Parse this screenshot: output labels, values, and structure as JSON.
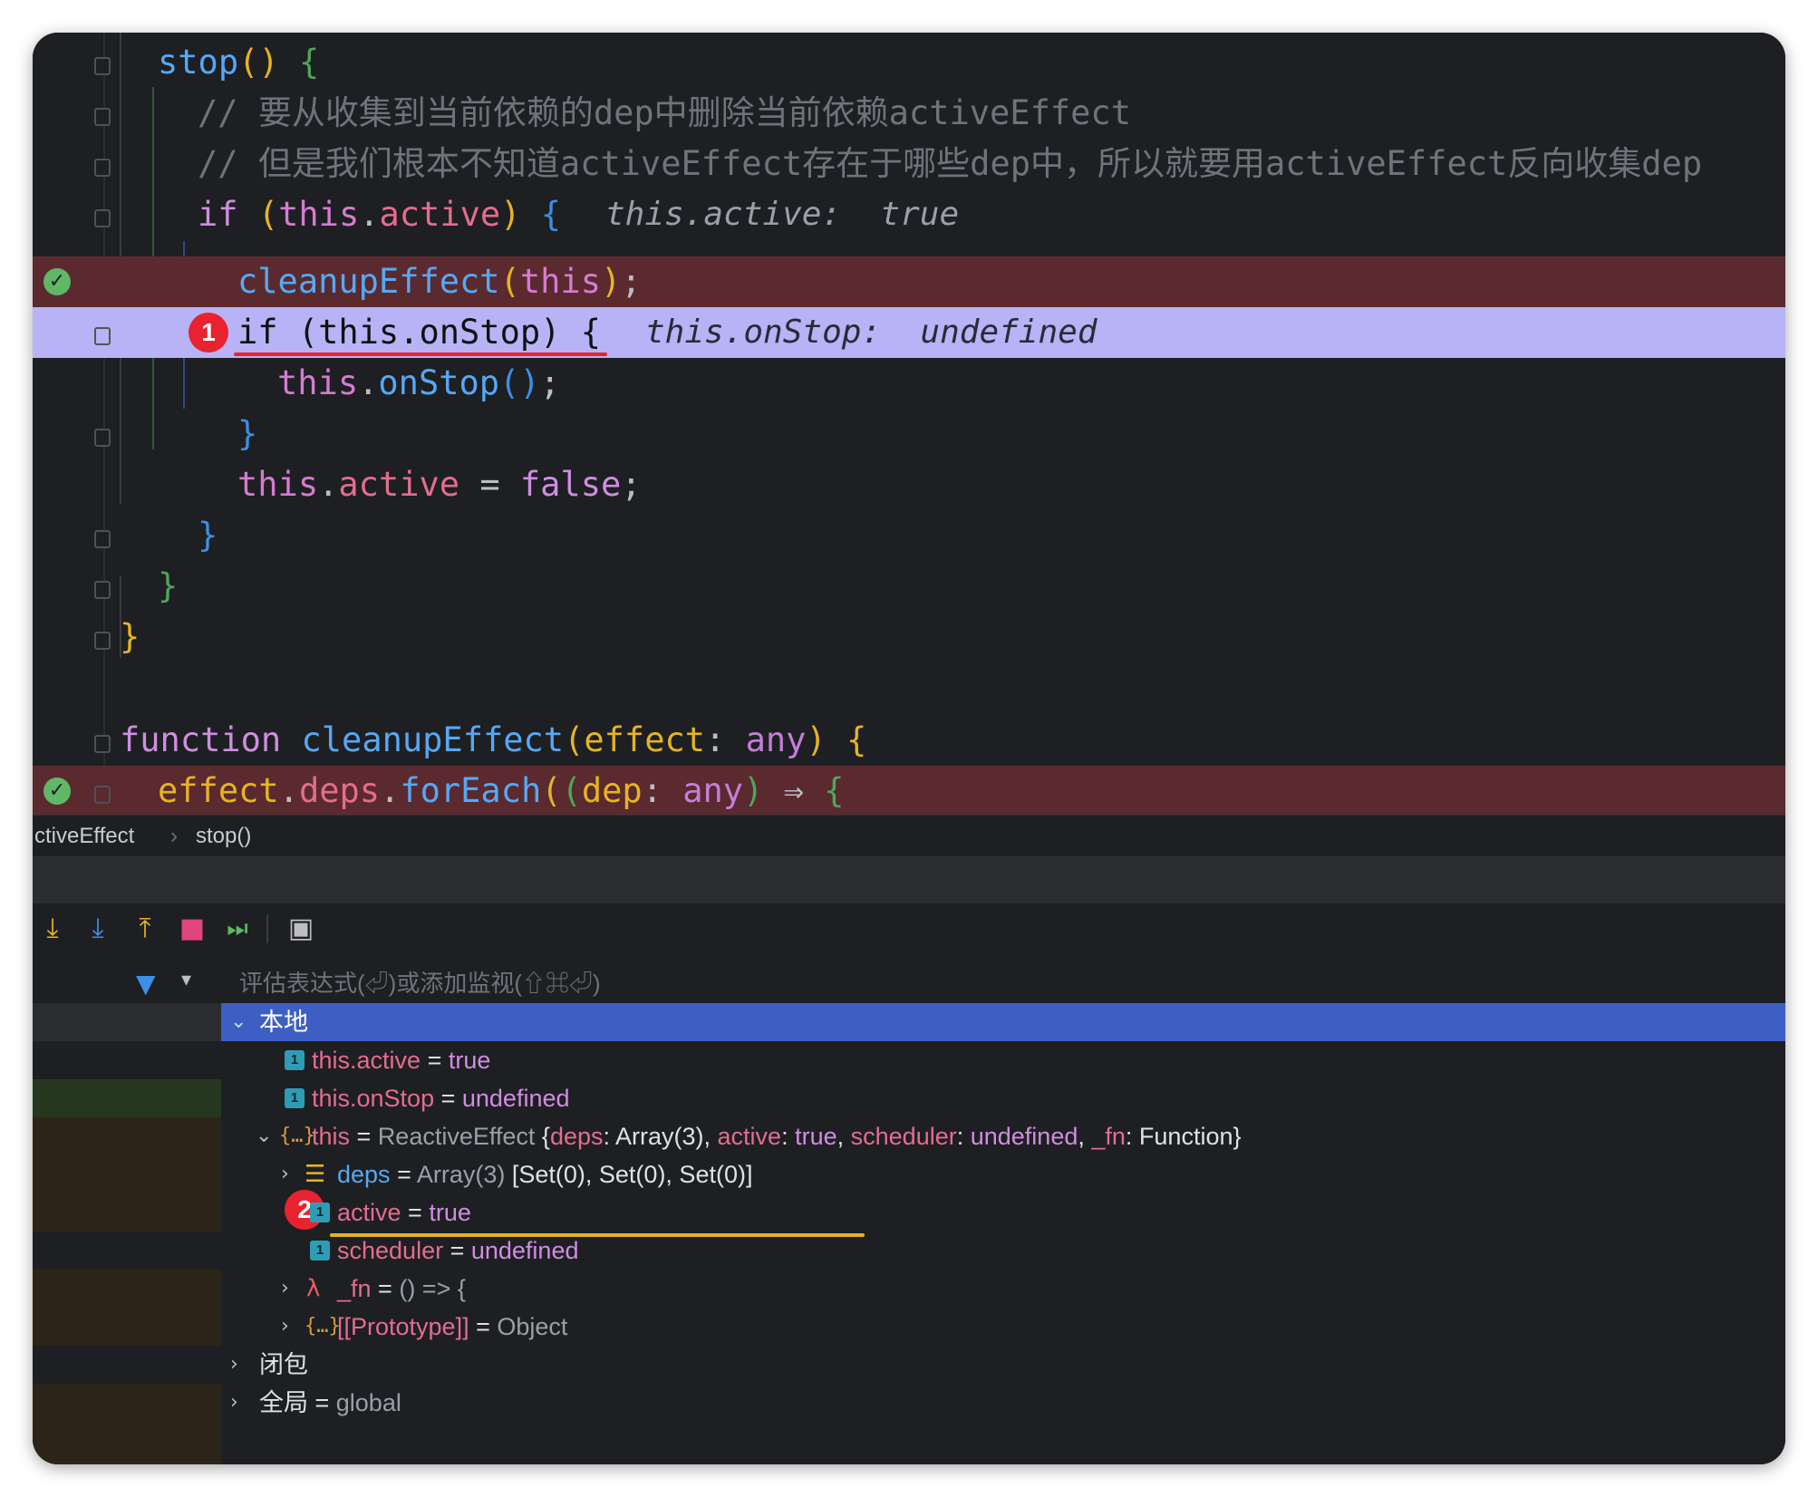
{
  "editor": {
    "lines": [
      {
        "kind": "code",
        "tokens": [
          [
            "stop",
            "fn"
          ],
          [
            "()",
            "p1"
          ],
          [
            " {",
            "p2"
          ]
        ]
      },
      {
        "kind": "comment",
        "text": "// 要从收集到当前依赖的dep中删除当前依赖activeEffect"
      },
      {
        "kind": "comment",
        "text": "// 但是我们根本不知道activeEffect存在于哪些dep中，所以就要用activeEffect反向收集dep"
      },
      {
        "kind": "code",
        "tokens": [
          [
            "if",
            "kw"
          ],
          [
            " ",
            ""
          ],
          [
            "(",
            "p1"
          ],
          [
            "this",
            "this"
          ],
          [
            ".",
            ""
          ],
          [
            "active",
            "prop"
          ],
          [
            ")",
            "p1"
          ],
          [
            " {",
            "p3"
          ]
        ],
        "inline": "this.active:  true"
      },
      {
        "kind": "code",
        "tokens": [
          [
            "cleanupEffect",
            "fn"
          ],
          [
            "(",
            "p1"
          ],
          [
            "this",
            "this"
          ],
          [
            ")",
            "p1"
          ],
          [
            ";",
            ""
          ]
        ]
      },
      {
        "kind": "code",
        "tokens": [
          [
            "if (this.onStop) {",
            ""
          ]
        ],
        "inline": "this.onStop:  undefined"
      },
      {
        "kind": "code",
        "tokens": [
          [
            "this",
            "this"
          ],
          [
            ".",
            ""
          ],
          [
            "onStop",
            "fn"
          ],
          [
            "()",
            "p3"
          ],
          [
            ";",
            ""
          ]
        ]
      },
      {
        "kind": "code",
        "tokens": [
          [
            "}",
            "p3"
          ]
        ]
      },
      {
        "kind": "code",
        "tokens": [
          [
            "this",
            "this"
          ],
          [
            ".",
            ""
          ],
          [
            "active",
            "prop"
          ],
          [
            " = ",
            ""
          ],
          [
            "false",
            "kw"
          ],
          [
            ";",
            ""
          ]
        ]
      },
      {
        "kind": "code",
        "tokens": [
          [
            "}",
            "p3"
          ]
        ]
      },
      {
        "kind": "code",
        "tokens": [
          [
            "}",
            "p2"
          ]
        ]
      },
      {
        "kind": "code",
        "tokens": [
          [
            "}",
            "p1"
          ]
        ]
      },
      {
        "kind": "code",
        "tokens": [
          [
            "function",
            "kw"
          ],
          [
            " ",
            ""
          ],
          [
            "cleanupEffect",
            "fn"
          ],
          [
            "(",
            "p1"
          ],
          [
            "effect",
            "param"
          ],
          [
            ": ",
            ""
          ],
          [
            "any",
            "type"
          ],
          [
            ")",
            "p1"
          ],
          [
            " {",
            "p1"
          ]
        ]
      },
      {
        "kind": "code",
        "tokens": [
          [
            "effect",
            "param"
          ],
          [
            ".",
            ""
          ],
          [
            "deps",
            "prop"
          ],
          [
            ".",
            ""
          ],
          [
            "forEach",
            "fn"
          ],
          [
            "(",
            "p1"
          ],
          [
            "(",
            "p2"
          ],
          [
            "dep",
            "param"
          ],
          [
            ": ",
            ""
          ],
          [
            "any",
            "type"
          ],
          [
            ")",
            "p2"
          ],
          [
            " ⇒ ",
            ""
          ],
          [
            "{",
            "p2"
          ]
        ]
      }
    ],
    "badge1": "1",
    "badge2": "2"
  },
  "breadcrumb": {
    "item1": "ctiveEffect",
    "sep": "›",
    "item2": "stop()"
  },
  "toolbar": {
    "buttons": [
      {
        "icon": "step-over-icon",
        "glyph": "⤓",
        "color": "#e6b422"
      },
      {
        "icon": "step-into-icon",
        "glyph": "⤓",
        "color": "#3d8ee6"
      },
      {
        "icon": "step-out-icon",
        "glyph": "⤒",
        "color": "#e6b422"
      },
      {
        "icon": "stop-frames-icon",
        "glyph": "■",
        "color": "#e0457b"
      },
      {
        "icon": "run-to-cursor-icon",
        "glyph": "⏭",
        "color": "#5fb865"
      },
      {
        "icon": "console-icon",
        "glyph": "▣",
        "color": "#bcbec4"
      }
    ]
  },
  "variables": {
    "filter_icon": "filter-icon",
    "eval_placeholder": "评估表达式(⏎)或添加监视(⇧⌘⏎)",
    "local_label": "本地",
    "rows": {
      "this_active_name": "this.active",
      "this_active_val": "true",
      "this_onstop_name": "this.onStop",
      "this_onstop_val": "undefined",
      "this_name": "this",
      "this_class": "ReactiveEffect",
      "this_summary": {
        "open": " {",
        "k1": "deps",
        "v1": ": Array(3), ",
        "k2": "active",
        "c2": ": ",
        "v2": "true",
        "s2": ", ",
        "k3": "scheduler",
        "c3": ": ",
        "v3": "undefined",
        "s3": ", ",
        "k4": "_fn",
        "v4": ": Function}"
      },
      "deps_name": "deps",
      "deps_class": "Array(3)",
      "deps_val": "[Set(0), Set(0), Set(0)]",
      "active_name": "active",
      "active_val": "true",
      "scheduler_name": "scheduler",
      "scheduler_val": "undefined",
      "fn_name": "_fn",
      "fn_val": "() => {",
      "proto_name": "[[Prototype]]",
      "proto_val": "Object",
      "closure_label": "闭包",
      "global_label": "全局",
      "global_val": "global"
    },
    "eq": " = "
  }
}
